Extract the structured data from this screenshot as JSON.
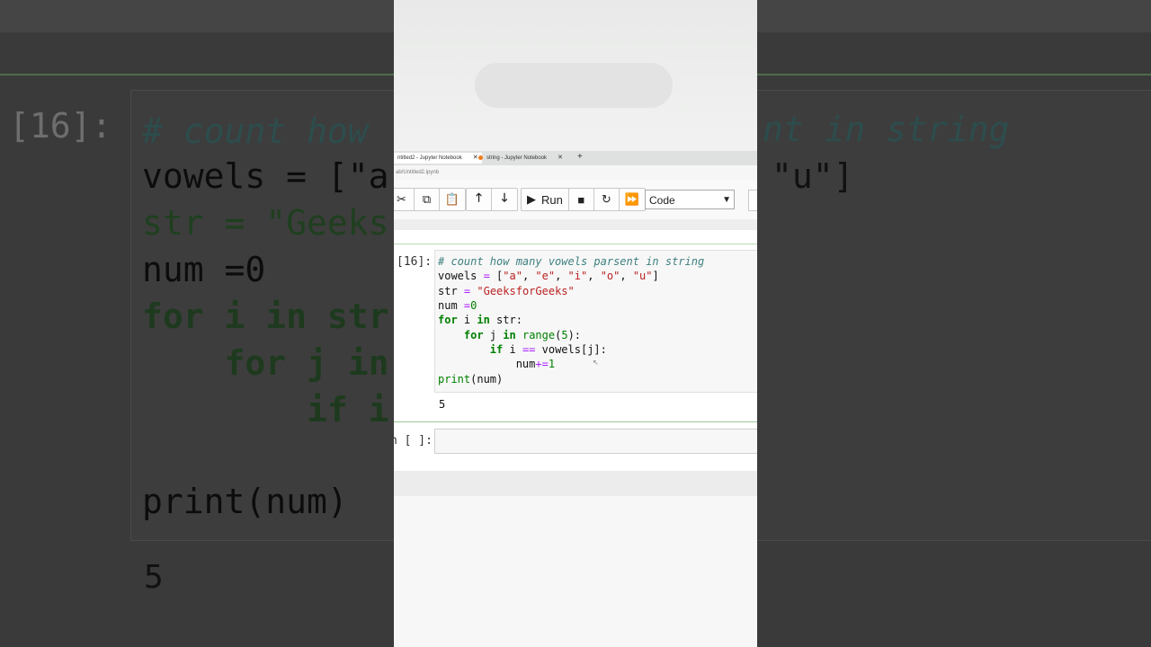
{
  "background": {
    "prompt": "[16]:",
    "lines": [
      "# count how",
      "vowels = [\"a",
      "str = \"Geeks",
      "num =0",
      "for i in str",
      "    for j in",
      "        if i",
      "",
      "print(num)"
    ],
    "right_line1": "nt in string",
    "right_line2": "\"u\"]",
    "output": "5"
  },
  "browser": {
    "tabs": [
      {
        "label": "ntitled2 - Jupyter Notebook",
        "active": true
      },
      {
        "label": "string - Jupyter Notebook",
        "active": false
      }
    ],
    "new_tab_symbol": "+",
    "address": "ab/Untitled2.ipynb"
  },
  "toolbar": {
    "run_label": "Run",
    "cell_type": "Code",
    "icons": [
      "cut-icon",
      "copy-icon",
      "paste-icon",
      "move-up-icon",
      "move-down-icon",
      "run-icon",
      "stop-icon",
      "restart-icon",
      "fast-forward-icon",
      "chevron-down-icon",
      "keyboard-icon"
    ]
  },
  "notebook": {
    "cell1": {
      "prompt": "[16]:",
      "code": [
        "# count how many vowels parsent in string",
        "vowels = [\"a\", \"e\", \"i\", \"o\", \"u\"]",
        "str = \"GeeksforGeeks\"",
        "num =0",
        "for i in str:",
        "    for j in range(5):",
        "        if i == vowels[j]:",
        "            num+=1",
        "print(num)"
      ],
      "output": "5"
    },
    "cell2": {
      "prompt": "n [ ]:"
    }
  },
  "colors": {
    "comment": "#408080",
    "keyword": "#008000",
    "string": "#ba2121",
    "operator": "#aa22ff",
    "selected_border": "#9ac897"
  }
}
